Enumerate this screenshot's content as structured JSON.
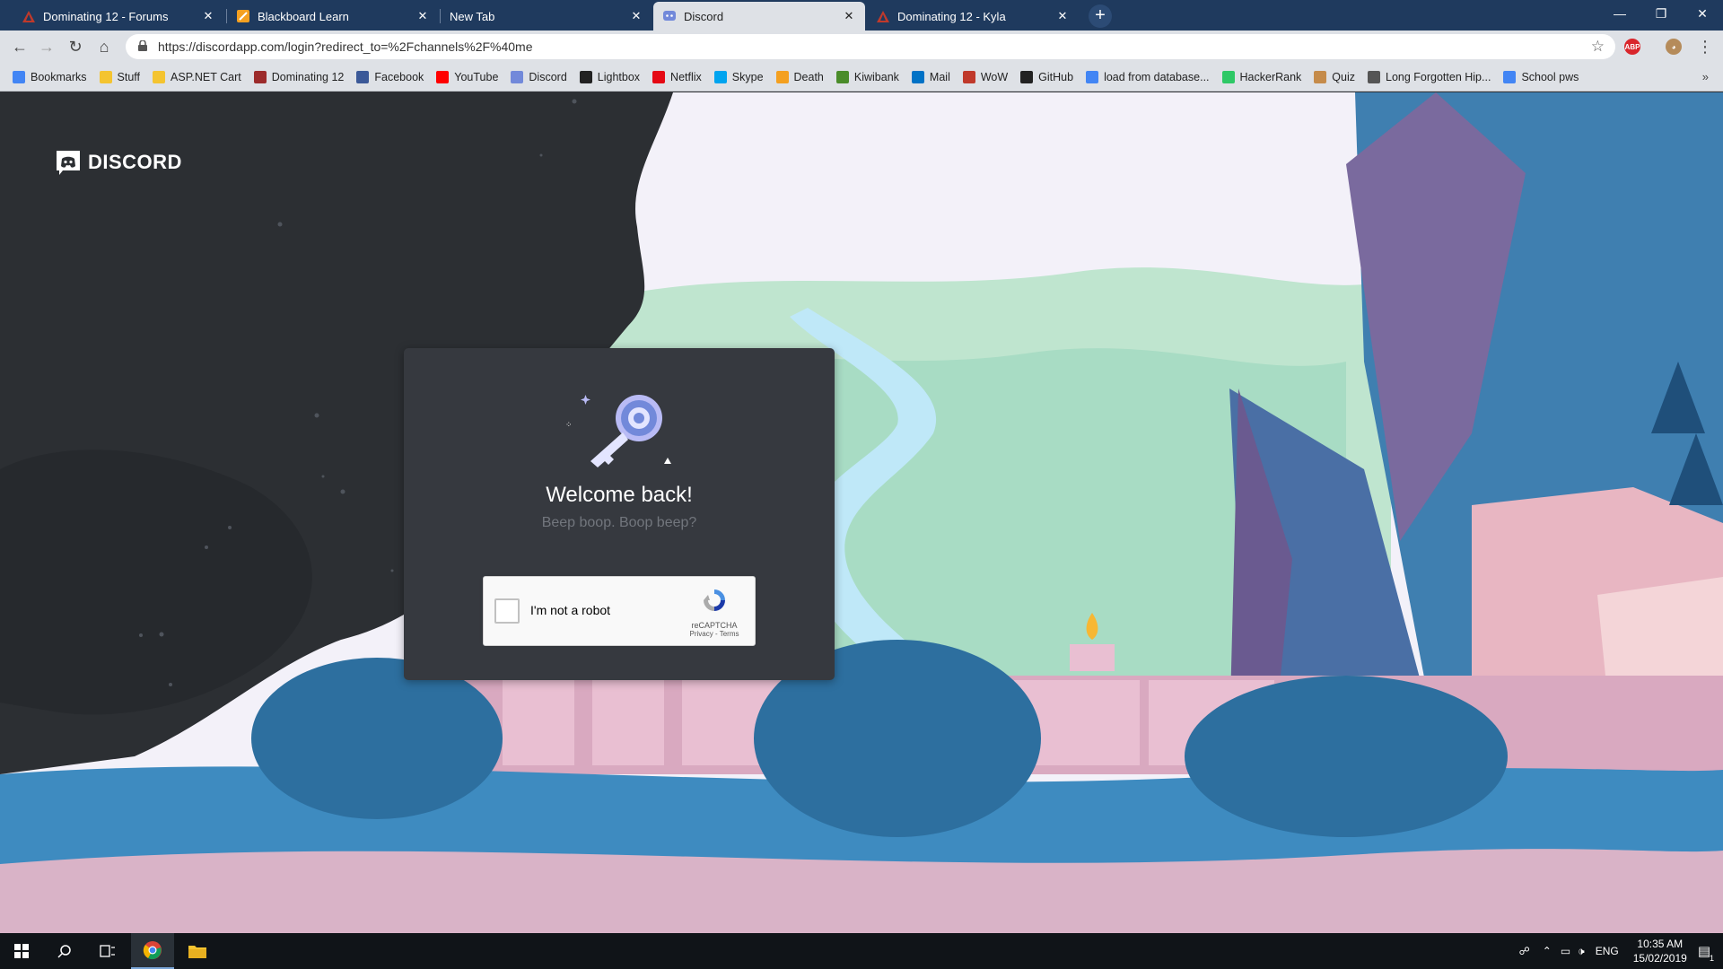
{
  "browser": {
    "tabs": [
      {
        "title": "Dominating 12 - Forums",
        "icon": "warning-triangle-icon",
        "active": false
      },
      {
        "title": "Blackboard Learn",
        "icon": "blackboard-icon",
        "active": false
      },
      {
        "title": "New Tab",
        "icon": "",
        "active": false
      },
      {
        "title": "Discord",
        "icon": "discord-icon",
        "active": true
      },
      {
        "title": "Dominating 12 - Kyla",
        "icon": "warning-triangle-icon",
        "active": false
      }
    ],
    "url": "https://discordapp.com/login?redirect_to=%2Fchannels%2F%40me",
    "bookmarks": [
      {
        "label": "Bookmarks",
        "icon": "star-icon",
        "color": "#4285f4"
      },
      {
        "label": "Stuff",
        "icon": "folder-icon",
        "color": "#f4c430"
      },
      {
        "label": "ASP.NET Cart",
        "icon": "folder-icon",
        "color": "#f4c430"
      },
      {
        "label": "Dominating 12",
        "icon": "warning-triangle-icon",
        "color": "#9c2b2b"
      },
      {
        "label": "Facebook",
        "icon": "facebook-icon",
        "color": "#3b5998"
      },
      {
        "label": "YouTube",
        "icon": "youtube-icon",
        "color": "#ff0000"
      },
      {
        "label": "Discord",
        "icon": "discord-icon",
        "color": "#7289da"
      },
      {
        "label": "Lightbox",
        "icon": "lightbox-icon",
        "color": "#222222"
      },
      {
        "label": "Netflix",
        "icon": "netflix-icon",
        "color": "#e50914"
      },
      {
        "label": "Skype",
        "icon": "windows-icon",
        "color": "#00a4ef"
      },
      {
        "label": "Death",
        "icon": "pencil-icon",
        "color": "#f4a020"
      },
      {
        "label": "Kiwibank",
        "icon": "kiwi-icon",
        "color": "#4a8c2a"
      },
      {
        "label": "Mail",
        "icon": "outlook-icon",
        "color": "#0072c6"
      },
      {
        "label": "WoW",
        "icon": "wow-icon",
        "color": "#c0392b"
      },
      {
        "label": "GitHub",
        "icon": "github-icon",
        "color": "#222222"
      },
      {
        "label": "load from database...",
        "icon": "google-icon",
        "color": "#4285f4"
      },
      {
        "label": "HackerRank",
        "icon": "hackerrank-icon",
        "color": "#2ec866"
      },
      {
        "label": "Quiz",
        "icon": "quiz-icon",
        "color": "#c58b4a"
      },
      {
        "label": "Long Forgotten Hip...",
        "icon": "hippo-icon",
        "color": "#555555"
      },
      {
        "label": "School pws",
        "icon": "google-icon",
        "color": "#4285f4"
      }
    ],
    "more_bookmarks": "»"
  },
  "page": {
    "logo_text": "DISCORD",
    "heading": "Welcome back!",
    "subheading": "Beep boop. Boop beep?",
    "recaptcha": {
      "label": "I'm not a robot",
      "brand": "reCAPTCHA",
      "links": "Privacy - Terms"
    }
  },
  "taskbar": {
    "language": "ENG",
    "time": "10:35 AM",
    "date": "15/02/2019",
    "notification_count": "1"
  },
  "colors": {
    "tabstrip": "#1f3a5e",
    "toolbar": "#dee1e6",
    "card": "#36393f",
    "blurple": "#7289da",
    "dark_bg": "#2f3136"
  }
}
